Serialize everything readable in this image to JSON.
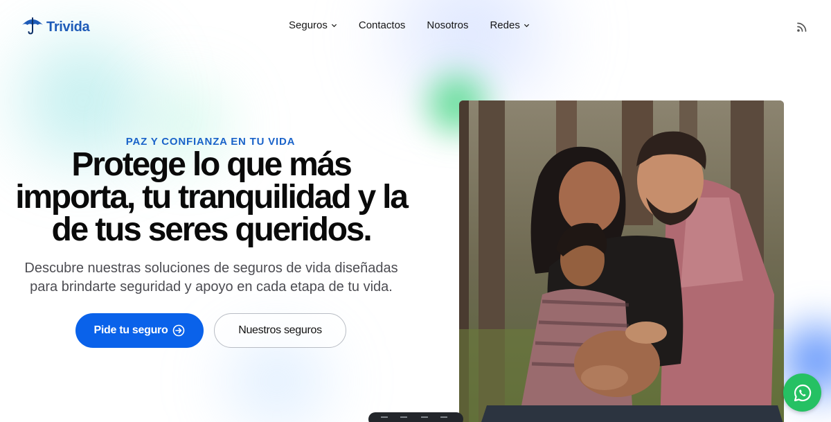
{
  "header": {
    "logo_text": "Trivida",
    "nav": [
      {
        "label": "Seguros",
        "has_dropdown": true
      },
      {
        "label": "Contactos",
        "has_dropdown": false
      },
      {
        "label": "Nosotros",
        "has_dropdown": false
      },
      {
        "label": "Redes",
        "has_dropdown": true
      }
    ],
    "rss_icon": "rss-icon"
  },
  "hero": {
    "eyebrow": "PAZ Y CONFIANZA EN TU VIDA",
    "headline_lines": [
      "Protege lo que más",
      "importa, tu tranquilidad y la",
      "de tus seres queridos."
    ],
    "subtitle_lines": [
      "Descubre nuestras soluciones de seguros de vida diseñadas",
      "para brindarte seguridad y apoyo en cada etapa de tu vida."
    ],
    "primary_cta": "Pide tu seguro",
    "secondary_cta": "Nuestros seguros"
  },
  "colors": {
    "brand": "#1e5bb8",
    "primary_button": "#0a62ea",
    "eyebrow": "#1a63c9",
    "whatsapp": "#25c163"
  },
  "icons": {
    "logo": "umbrella-icon",
    "cta": "arrow-right-circle-icon",
    "floating": "whatsapp-icon"
  }
}
